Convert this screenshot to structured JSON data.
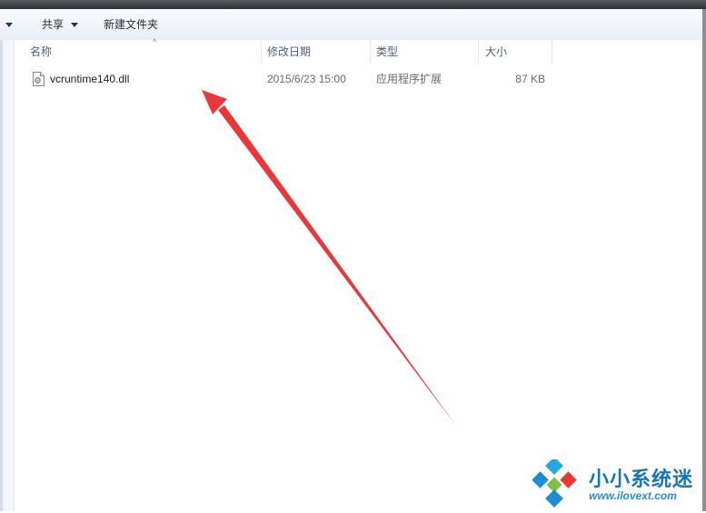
{
  "toolbar": {
    "organize_arrow": "▾",
    "share_label": "共享",
    "new_folder_label": "新建文件夹"
  },
  "columns": {
    "name": "名称",
    "modified": "修改日期",
    "type": "类型",
    "size": "大小"
  },
  "files": [
    {
      "name": "vcruntime140.dll",
      "modified": "2015/6/23 15:00",
      "type": "应用程序扩展",
      "size": "87 KB",
      "icon": "dll-file-icon"
    }
  ],
  "annotation": {
    "arrow_color": "#e8383b"
  },
  "watermark": {
    "title": "小小系统迷",
    "url": "www.ilovext.com"
  }
}
